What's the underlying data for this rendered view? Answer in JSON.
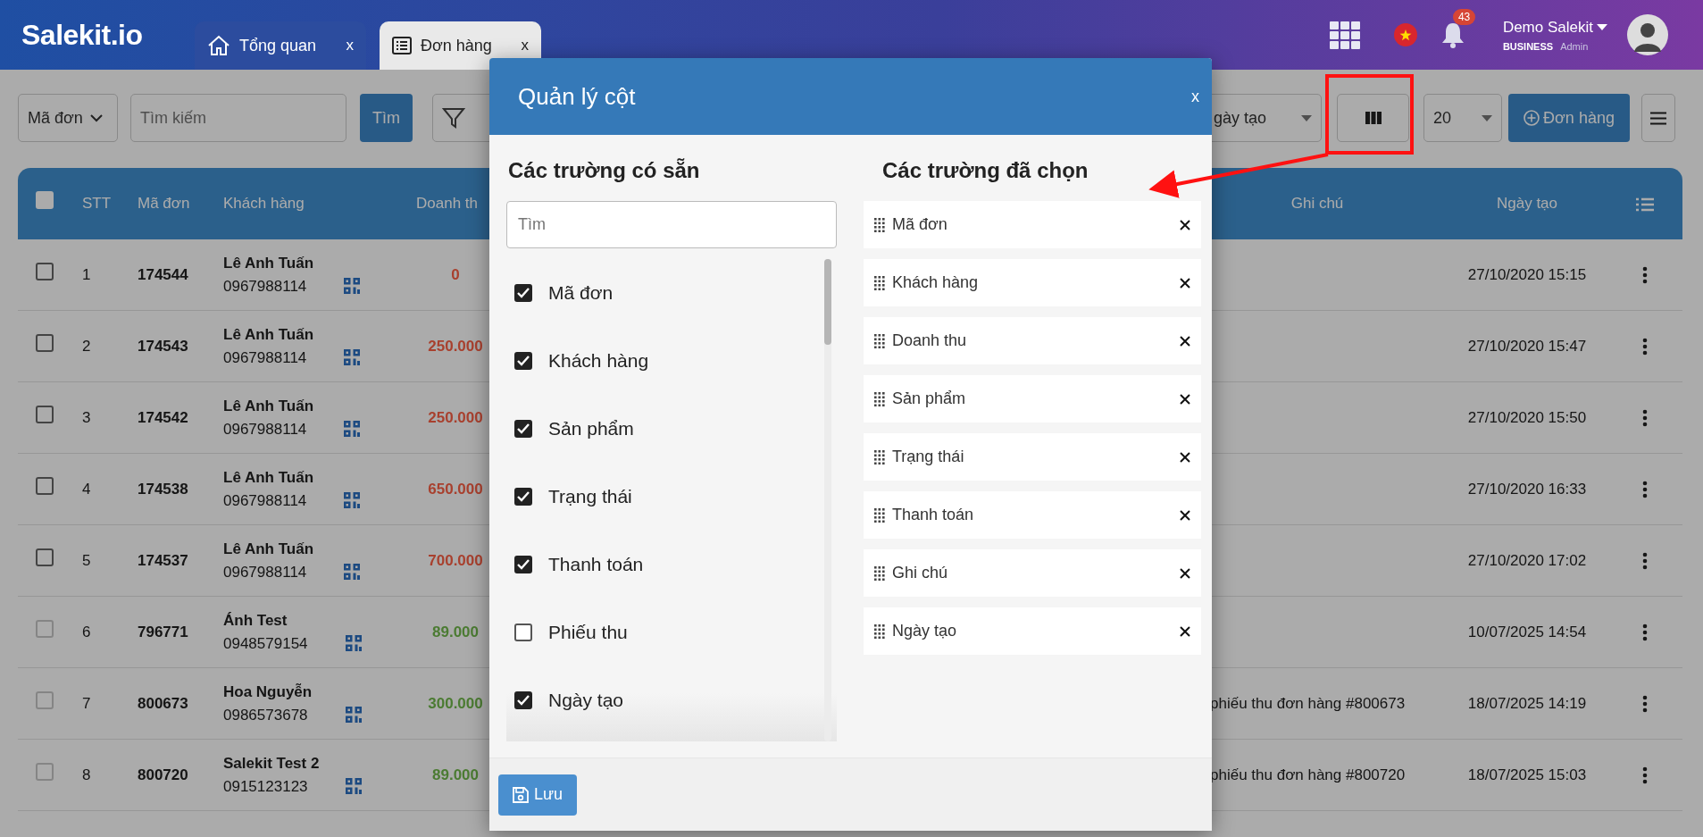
{
  "header": {
    "logo": "Salekit.io",
    "tabs": [
      {
        "label": "Tổng quan",
        "close": "x",
        "selected": false
      },
      {
        "label": "Đơn hàng",
        "close": "x",
        "selected": true
      }
    ],
    "notifications": "43",
    "user": {
      "name": "Demo Salekit",
      "plan": "BUSINESS",
      "role": "Admin"
    }
  },
  "toolbar": {
    "search_by": "Mã đơn",
    "search": {
      "placeholder": "Tìm kiếm"
    },
    "search_button": "Tìm",
    "sort_by": "gày tạo",
    "page_size": "20",
    "add_button": "Đơn hàng"
  },
  "table": {
    "select_all_checked": false,
    "columns": [
      {
        "label": "STT"
      },
      {
        "label": "Mã đơn"
      },
      {
        "label": "Khách hàng"
      },
      {
        "label": "Doanh th"
      },
      {
        "label": "Ghi chú"
      },
      {
        "label": "Ngày tạo"
      }
    ],
    "rows": [
      {
        "stt": "1",
        "code": "174544",
        "customer": "Lê Anh Tuấn",
        "phone": "0967988114",
        "revenue": "0",
        "color": "#a8402e",
        "note": "",
        "date": "27/10/2020 15:15",
        "checked": false,
        "disabled": false
      },
      {
        "stt": "2",
        "code": "174543",
        "customer": "Lê Anh Tuấn",
        "phone": "0967988114",
        "revenue": "250.000",
        "color": "#a8402e",
        "note": "",
        "date": "27/10/2020 15:47",
        "checked": false,
        "disabled": false
      },
      {
        "stt": "3",
        "code": "174542",
        "customer": "Lê Anh Tuấn",
        "phone": "0967988114",
        "revenue": "250.000",
        "color": "#a8402e",
        "note": "",
        "date": "27/10/2020 15:50",
        "checked": false,
        "disabled": false
      },
      {
        "stt": "4",
        "code": "174538",
        "customer": "Lê Anh Tuấn",
        "phone": "0967988114",
        "revenue": "650.000",
        "color": "#a8402e",
        "note": "",
        "date": "27/10/2020 16:33",
        "checked": false,
        "disabled": false
      },
      {
        "stt": "5",
        "code": "174537",
        "customer": "Lê Anh Tuấn",
        "phone": "0967988114",
        "revenue": "700.000",
        "color": "#a8402e",
        "note": "",
        "date": "27/10/2020 17:02",
        "checked": false,
        "disabled": false
      },
      {
        "stt": "6",
        "code": "796771",
        "customer": "Ánh Test",
        "phone": "0948579154",
        "revenue": "89.000",
        "color": "#4b7b32",
        "note": "",
        "date": "10/07/2025 14:54",
        "checked": false,
        "disabled": true
      },
      {
        "stt": "7",
        "code": "800673",
        "customer": "Hoa Nguyễn",
        "phone": "0986573678",
        "revenue": "300.000",
        "color": "#4b7b32",
        "note": "phiếu thu đơn hàng #800673",
        "date": "18/07/2025 14:19",
        "checked": false,
        "disabled": true
      },
      {
        "stt": "8",
        "code": "800720",
        "customer": "Salekit Test 2",
        "phone": "0915123123",
        "revenue": "89.000",
        "color": "#4b7b32",
        "note": "phiếu thu đơn hàng #800720",
        "date": "18/07/2025 15:03",
        "checked": false,
        "disabled": true
      }
    ]
  },
  "modal": {
    "title": "Quản lý cột",
    "close": "x",
    "available": {
      "title": "Các trường có sẵn",
      "search": {
        "placeholder": "Tìm"
      },
      "fields": [
        {
          "label": "Mã đơn",
          "checked": true
        },
        {
          "label": "Khách hàng",
          "checked": true
        },
        {
          "label": "Sản phẩm",
          "checked": true
        },
        {
          "label": "Trạng thái",
          "checked": true
        },
        {
          "label": "Thanh toán",
          "checked": true
        },
        {
          "label": "Phiếu thu",
          "checked": false
        },
        {
          "label": "Ngày tạo",
          "checked": true
        }
      ]
    },
    "chosen": {
      "title": "Các trường đã chọn",
      "fields": [
        {
          "label": "Mã đơn"
        },
        {
          "label": "Khách hàng"
        },
        {
          "label": "Doanh thu"
        },
        {
          "label": "Sản phẩm"
        },
        {
          "label": "Trạng thái"
        },
        {
          "label": "Thanh toán"
        },
        {
          "label": "Ghi chú"
        },
        {
          "label": "Ngày tạo"
        }
      ]
    },
    "save_button": "Lưu"
  }
}
